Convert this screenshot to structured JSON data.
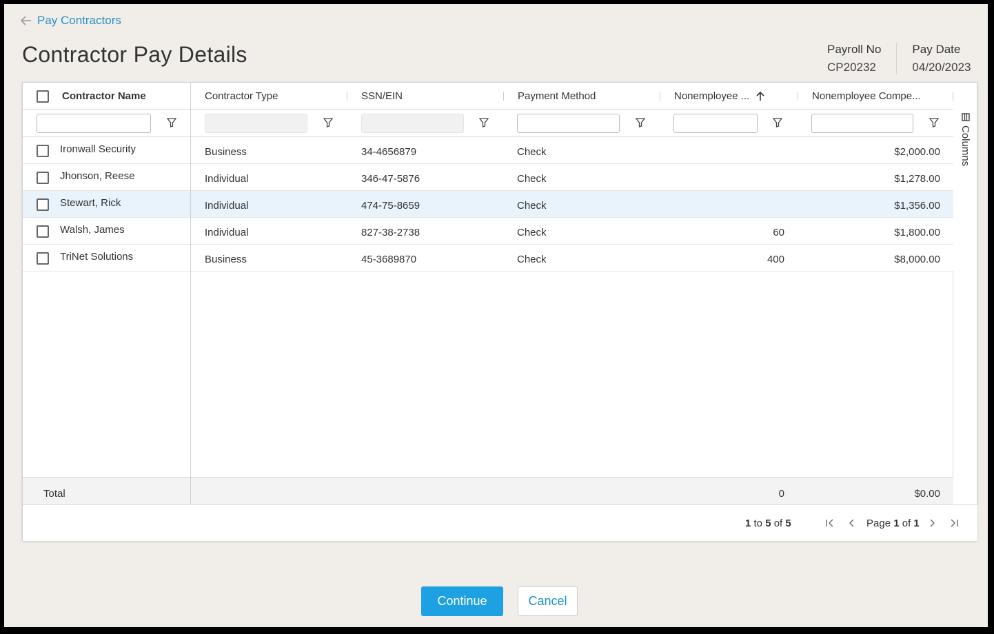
{
  "nav": {
    "back_label": "Pay Contractors"
  },
  "page": {
    "title": "Contractor Pay Details"
  },
  "meta": {
    "payroll_label": "Payroll No",
    "payroll_value": "CP20232",
    "paydate_label": "Pay Date",
    "paydate_value": "04/20/2023"
  },
  "grid": {
    "columns": {
      "name": "Contractor Name",
      "type": "Contractor Type",
      "ssn": "SSN/EIN",
      "method": "Payment Method",
      "nonemp1": "Nonemployee ...",
      "nonemp2": "Nonemployee Compe..."
    },
    "rows": [
      {
        "name": "Ironwall Security",
        "type": "Business",
        "ssn": "34-4656879",
        "method": "Check",
        "nonemp1": "",
        "nonemp2": "$2,000.00"
      },
      {
        "name": "Jhonson, Reese",
        "type": "Individual",
        "ssn": "346-47-5876",
        "method": "Check",
        "nonemp1": "",
        "nonemp2": "$1,278.00"
      },
      {
        "name": "Stewart, Rick",
        "type": "Individual",
        "ssn": "474-75-8659",
        "method": "Check",
        "nonemp1": "",
        "nonemp2": "$1,356.00"
      },
      {
        "name": "Walsh, James",
        "type": "Individual",
        "ssn": "827-38-2738",
        "method": "Check",
        "nonemp1": "60",
        "nonemp2": "$1,800.00"
      },
      {
        "name": "TriNet Solutions",
        "type": "Business",
        "ssn": "45-3689870",
        "method": "Check",
        "nonemp1": "400",
        "nonemp2": "$8,000.00"
      }
    ],
    "total": {
      "label": "Total",
      "nonemp1": "0",
      "nonemp2": "$0.00"
    },
    "side_panel": {
      "columns_label": "Columns"
    }
  },
  "pagination": {
    "from": "1",
    "to_word": "to",
    "to": "5",
    "of_word": "of",
    "total": "5",
    "page_word": "Page",
    "page": "1",
    "page_of_word": "of",
    "pages": "1"
  },
  "actions": {
    "continue_label": "Continue",
    "cancel_label": "Cancel"
  },
  "colors": {
    "accent": "#1da1e2",
    "link": "#2a8fc6",
    "highlight_row": "#e9f3fc",
    "background": "#f1eee9"
  }
}
